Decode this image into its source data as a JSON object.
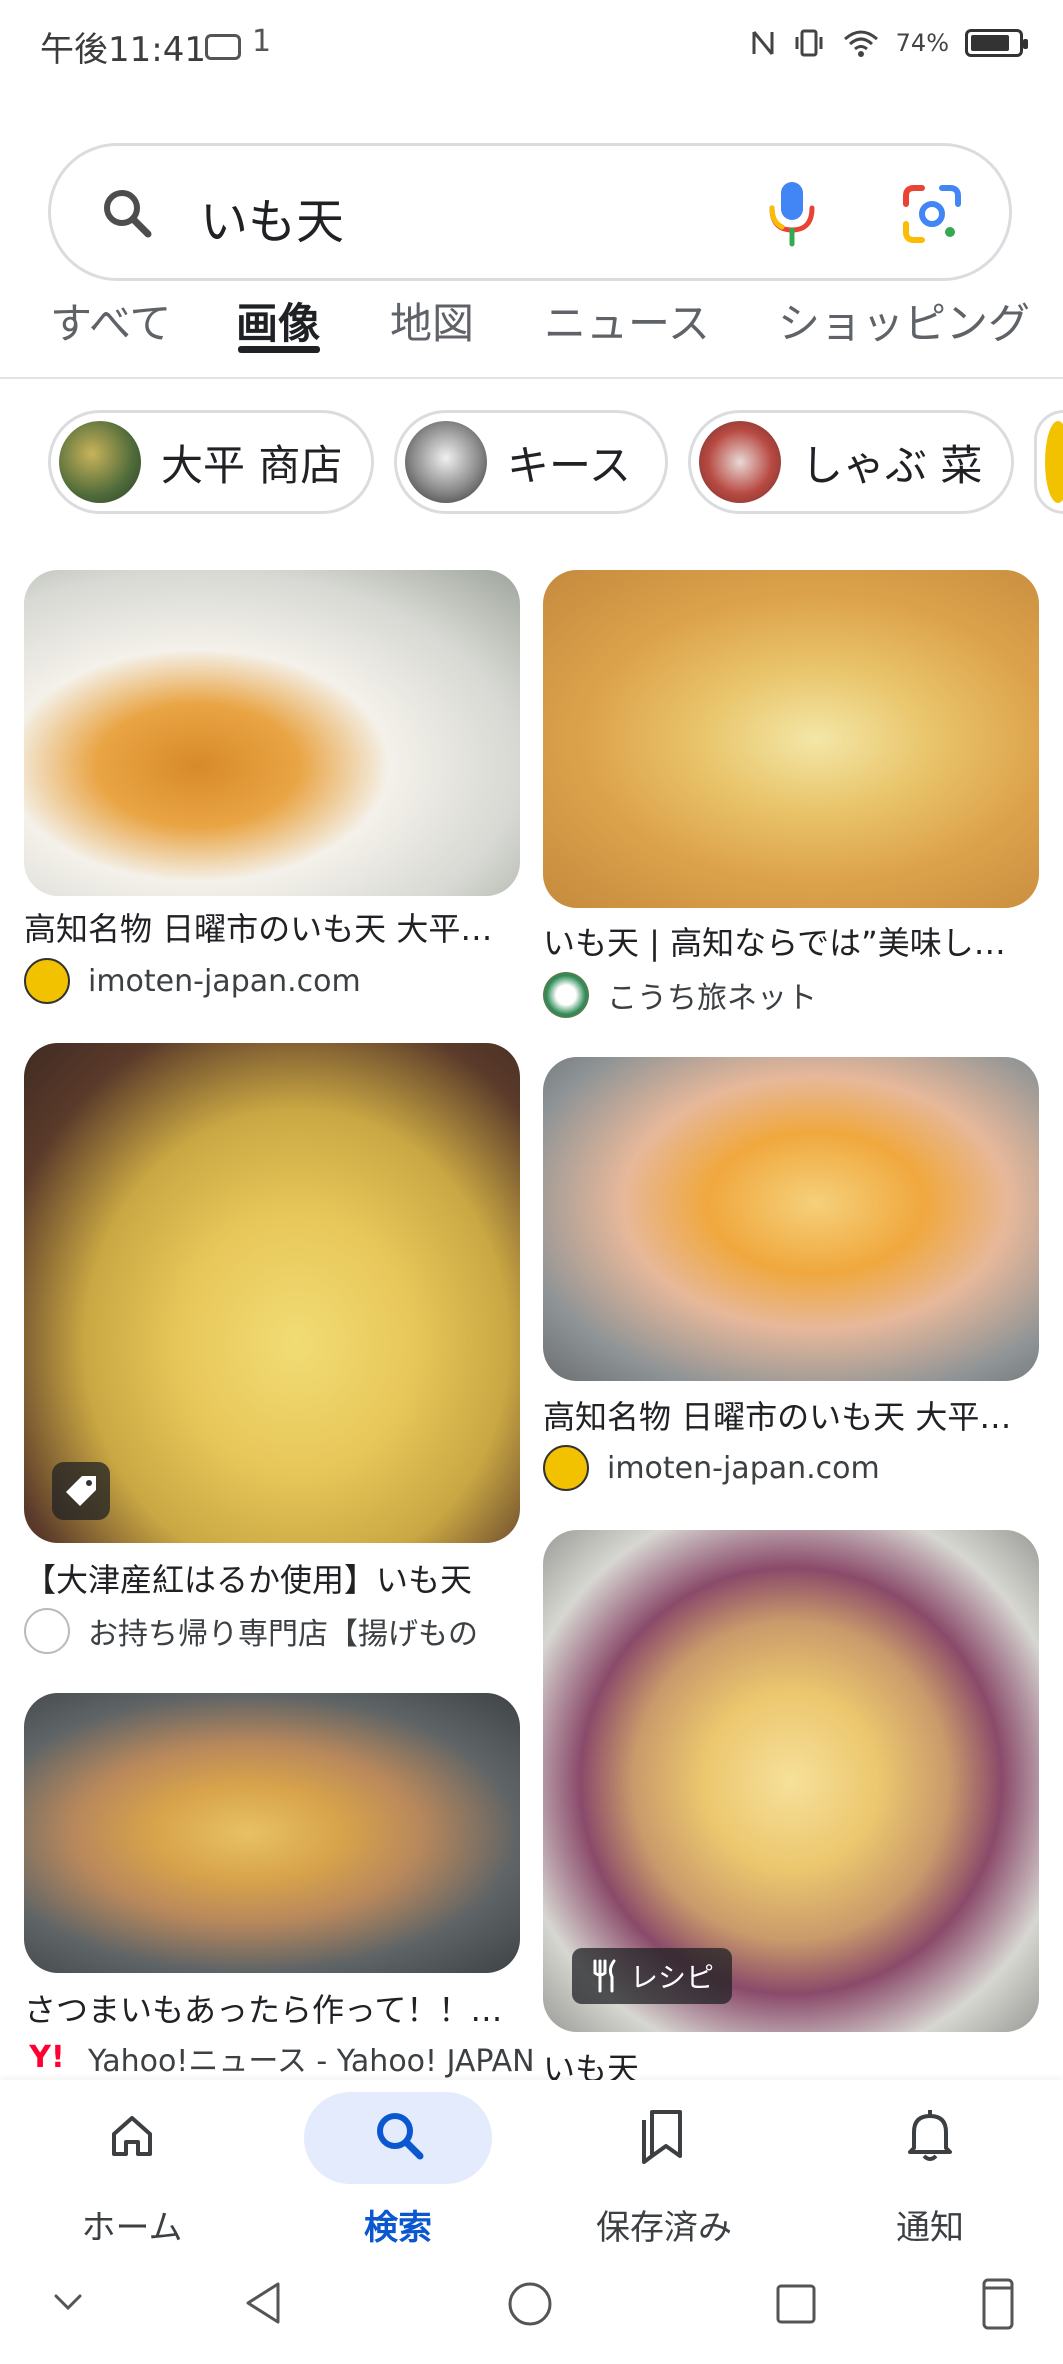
{
  "status_bar": {
    "time": "午後11:41",
    "message_count": "1",
    "battery_percent": "74%",
    "battery_level": 0.74
  },
  "search": {
    "query": "いも天",
    "icons": [
      "search-icon",
      "mic-icon",
      "google-lens-icon"
    ]
  },
  "tabs": [
    {
      "label": "すべて"
    },
    {
      "label": "画像",
      "active": true
    },
    {
      "label": "地図"
    },
    {
      "label": "ニュース"
    },
    {
      "label": "ショッピング"
    }
  ],
  "chips": [
    {
      "label": "大平 商店"
    },
    {
      "label": "キース"
    },
    {
      "label": "しゃぶ 菜"
    }
  ],
  "results": [
    {
      "title": "高知名物 日曜市のいも天 大平…",
      "source": "imoten-japan.com"
    },
    {
      "title": "いも天 | 高知ならでは”美味し…",
      "source": "こうち旅ネット"
    },
    {
      "title": "【大津産紅はるか使用】いも天",
      "source": "お持ち帰り専門店【揚げもの",
      "badge": "tag-icon"
    },
    {
      "title": "高知名物 日曜市のいも天 大平…",
      "source": "imoten-japan.com"
    },
    {
      "title": "さつまいもあったら作って！！…",
      "source": "Yahoo!ニュース - Yahoo! JAPAN"
    },
    {
      "title": "いも天",
      "source": "",
      "badge_label": "レシピ"
    }
  ],
  "bottom_nav": [
    {
      "label": "ホーム",
      "icon": "home-icon"
    },
    {
      "label": "検索",
      "icon": "search-icon",
      "active": true
    },
    {
      "label": "保存済み",
      "icon": "bookmarks-icon"
    },
    {
      "label": "通知",
      "icon": "bell-icon"
    }
  ],
  "colors": {
    "accent": "#0b57d0",
    "nav_pill": "#e3ebfd",
    "border": "#dadce0"
  }
}
